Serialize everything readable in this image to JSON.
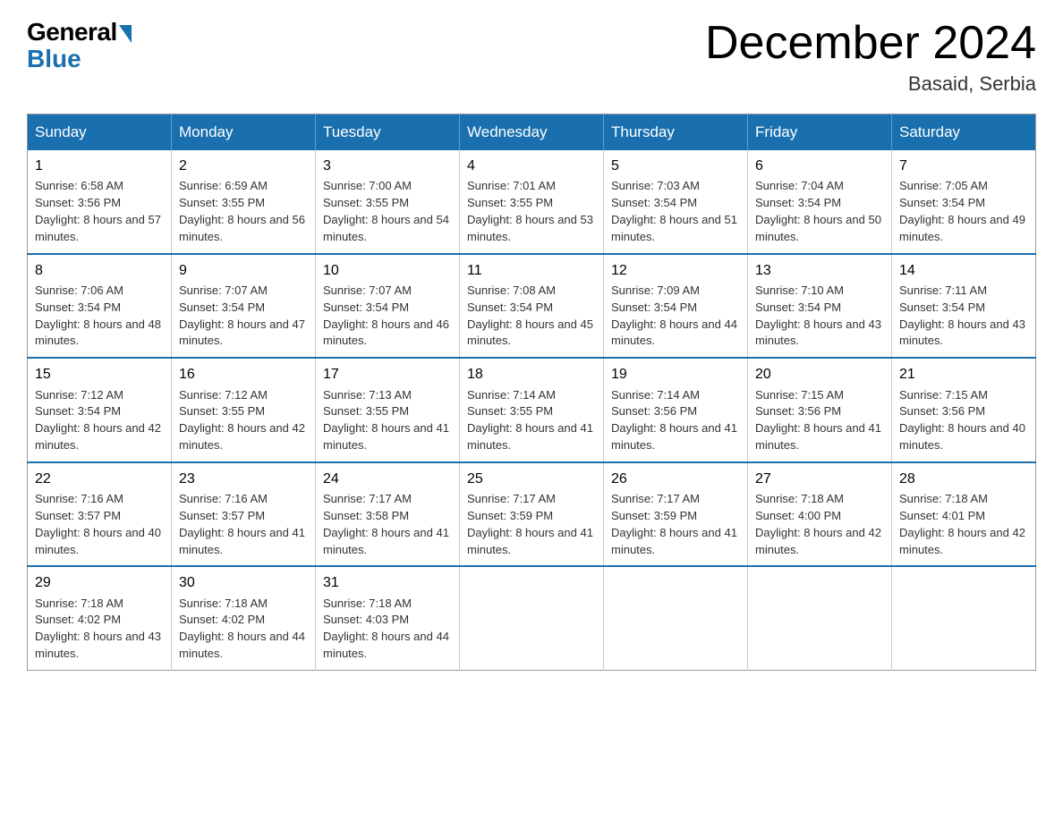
{
  "logo": {
    "general": "General",
    "blue": "Blue"
  },
  "title": "December 2024",
  "location": "Basaid, Serbia",
  "days_header": [
    "Sunday",
    "Monday",
    "Tuesday",
    "Wednesday",
    "Thursday",
    "Friday",
    "Saturday"
  ],
  "weeks": [
    [
      {
        "day": "1",
        "sunrise": "6:58 AM",
        "sunset": "3:56 PM",
        "daylight": "8 hours and 57 minutes."
      },
      {
        "day": "2",
        "sunrise": "6:59 AM",
        "sunset": "3:55 PM",
        "daylight": "8 hours and 56 minutes."
      },
      {
        "day": "3",
        "sunrise": "7:00 AM",
        "sunset": "3:55 PM",
        "daylight": "8 hours and 54 minutes."
      },
      {
        "day": "4",
        "sunrise": "7:01 AM",
        "sunset": "3:55 PM",
        "daylight": "8 hours and 53 minutes."
      },
      {
        "day": "5",
        "sunrise": "7:03 AM",
        "sunset": "3:54 PM",
        "daylight": "8 hours and 51 minutes."
      },
      {
        "day": "6",
        "sunrise": "7:04 AM",
        "sunset": "3:54 PM",
        "daylight": "8 hours and 50 minutes."
      },
      {
        "day": "7",
        "sunrise": "7:05 AM",
        "sunset": "3:54 PM",
        "daylight": "8 hours and 49 minutes."
      }
    ],
    [
      {
        "day": "8",
        "sunrise": "7:06 AM",
        "sunset": "3:54 PM",
        "daylight": "8 hours and 48 minutes."
      },
      {
        "day": "9",
        "sunrise": "7:07 AM",
        "sunset": "3:54 PM",
        "daylight": "8 hours and 47 minutes."
      },
      {
        "day": "10",
        "sunrise": "7:07 AM",
        "sunset": "3:54 PM",
        "daylight": "8 hours and 46 minutes."
      },
      {
        "day": "11",
        "sunrise": "7:08 AM",
        "sunset": "3:54 PM",
        "daylight": "8 hours and 45 minutes."
      },
      {
        "day": "12",
        "sunrise": "7:09 AM",
        "sunset": "3:54 PM",
        "daylight": "8 hours and 44 minutes."
      },
      {
        "day": "13",
        "sunrise": "7:10 AM",
        "sunset": "3:54 PM",
        "daylight": "8 hours and 43 minutes."
      },
      {
        "day": "14",
        "sunrise": "7:11 AM",
        "sunset": "3:54 PM",
        "daylight": "8 hours and 43 minutes."
      }
    ],
    [
      {
        "day": "15",
        "sunrise": "7:12 AM",
        "sunset": "3:54 PM",
        "daylight": "8 hours and 42 minutes."
      },
      {
        "day": "16",
        "sunrise": "7:12 AM",
        "sunset": "3:55 PM",
        "daylight": "8 hours and 42 minutes."
      },
      {
        "day": "17",
        "sunrise": "7:13 AM",
        "sunset": "3:55 PM",
        "daylight": "8 hours and 41 minutes."
      },
      {
        "day": "18",
        "sunrise": "7:14 AM",
        "sunset": "3:55 PM",
        "daylight": "8 hours and 41 minutes."
      },
      {
        "day": "19",
        "sunrise": "7:14 AM",
        "sunset": "3:56 PM",
        "daylight": "8 hours and 41 minutes."
      },
      {
        "day": "20",
        "sunrise": "7:15 AM",
        "sunset": "3:56 PM",
        "daylight": "8 hours and 41 minutes."
      },
      {
        "day": "21",
        "sunrise": "7:15 AM",
        "sunset": "3:56 PM",
        "daylight": "8 hours and 40 minutes."
      }
    ],
    [
      {
        "day": "22",
        "sunrise": "7:16 AM",
        "sunset": "3:57 PM",
        "daylight": "8 hours and 40 minutes."
      },
      {
        "day": "23",
        "sunrise": "7:16 AM",
        "sunset": "3:57 PM",
        "daylight": "8 hours and 41 minutes."
      },
      {
        "day": "24",
        "sunrise": "7:17 AM",
        "sunset": "3:58 PM",
        "daylight": "8 hours and 41 minutes."
      },
      {
        "day": "25",
        "sunrise": "7:17 AM",
        "sunset": "3:59 PM",
        "daylight": "8 hours and 41 minutes."
      },
      {
        "day": "26",
        "sunrise": "7:17 AM",
        "sunset": "3:59 PM",
        "daylight": "8 hours and 41 minutes."
      },
      {
        "day": "27",
        "sunrise": "7:18 AM",
        "sunset": "4:00 PM",
        "daylight": "8 hours and 42 minutes."
      },
      {
        "day": "28",
        "sunrise": "7:18 AM",
        "sunset": "4:01 PM",
        "daylight": "8 hours and 42 minutes."
      }
    ],
    [
      {
        "day": "29",
        "sunrise": "7:18 AM",
        "sunset": "4:02 PM",
        "daylight": "8 hours and 43 minutes."
      },
      {
        "day": "30",
        "sunrise": "7:18 AM",
        "sunset": "4:02 PM",
        "daylight": "8 hours and 44 minutes."
      },
      {
        "day": "31",
        "sunrise": "7:18 AM",
        "sunset": "4:03 PM",
        "daylight": "8 hours and 44 minutes."
      },
      null,
      null,
      null,
      null
    ]
  ]
}
